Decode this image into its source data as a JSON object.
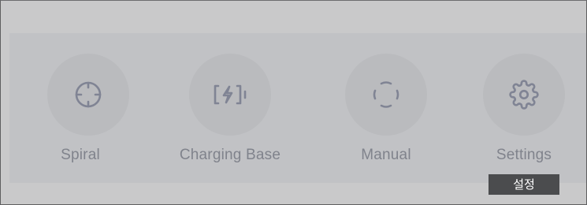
{
  "toolbar": {
    "buttons": [
      {
        "label": "Spiral",
        "icon": "crosshair-icon"
      },
      {
        "label": "Charging Base",
        "icon": "charging-icon"
      },
      {
        "label": "Manual",
        "icon": "manual-icon"
      },
      {
        "label": "Settings",
        "icon": "gear-icon"
      }
    ]
  },
  "tooltip": {
    "text": "설정"
  },
  "colors": {
    "background": "#c9c9ca",
    "panel": "#c1c2c5",
    "button_circle": "#babbbe",
    "icon": "#808494",
    "label": "#80838c",
    "tooltip_bg": "#4b4c4e",
    "tooltip_text": "#ffffff"
  }
}
